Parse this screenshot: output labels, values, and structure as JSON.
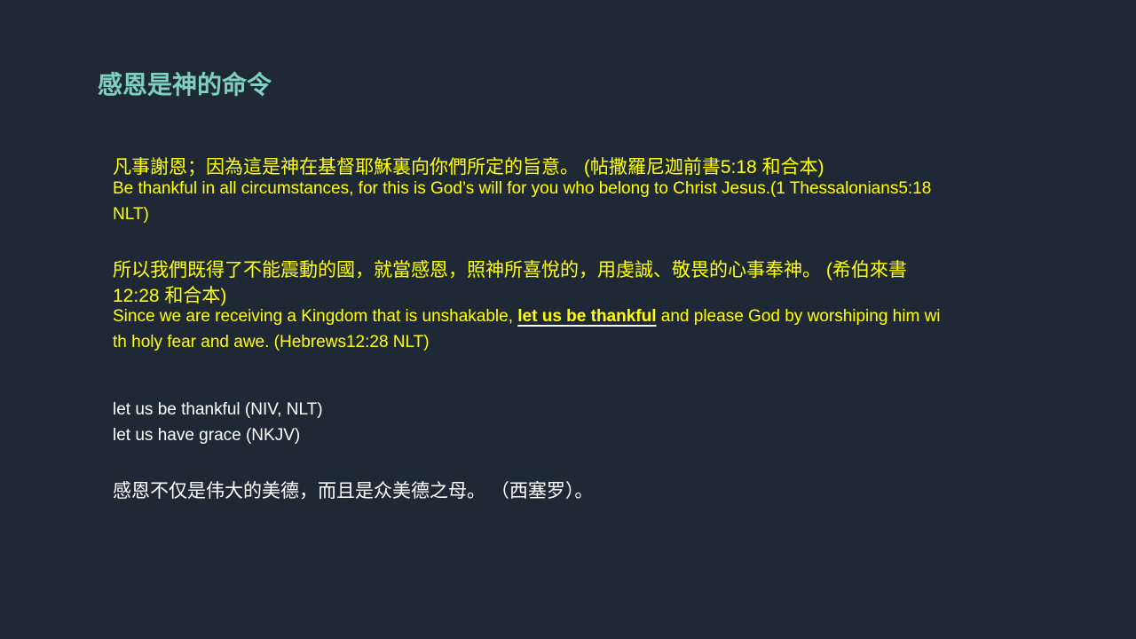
{
  "title": "感恩是神的命令",
  "verse1": {
    "zh": "凡事謝恩；因為這是神在基督耶穌裏向你們所定的旨意。 (帖撒羅尼迦前書5:18 和合本)",
    "en_line1": "Be thankful in all circumstances, for this is God’s will for you who belong to Christ Jesus.(1 Thessalonians5:18",
    "en_line2": "NLT)"
  },
  "verse2": {
    "zh_line1": "所以我們既得了不能震動的國，就當感恩，照神所喜悅的，用虔誠、敬畏的心事奉神。 (希伯來書",
    "zh_line2": "12:28 和合本)",
    "en_before": "Since we are receiving a Kingdom that is unshakable, ",
    "en_emphasis": "let us be thankful",
    "en_after": " and please God by worshiping him wi",
    "en_line2": "th holy fear and awe. (Hebrews12:28 NLT)"
  },
  "translations": [
    "let us be thankful (NIV, NLT)",
    "let us have grace (NKJV)"
  ],
  "quote": "感恩不仅是伟大的美德，而且是众美德之母。 （西塞罗）。"
}
